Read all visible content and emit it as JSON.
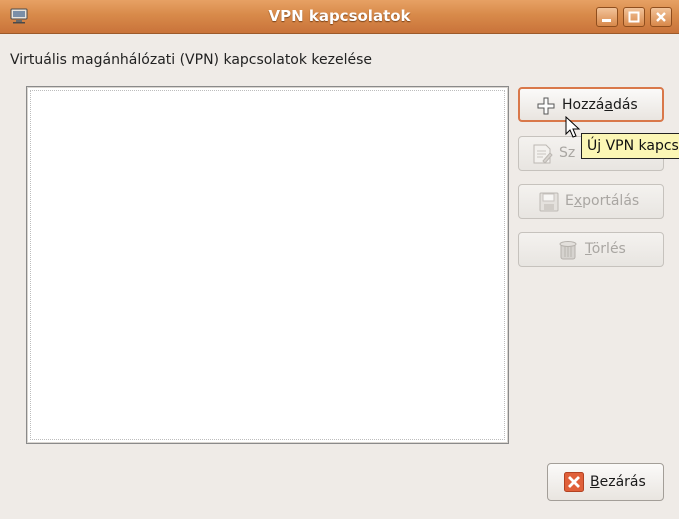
{
  "window": {
    "title": "VPN kapcsolatok"
  },
  "dialog": {
    "subtitle": "Virtuális magánhálózati (VPN) kapcsolatok kezelése",
    "buttons": {
      "add": {
        "pre": "Hozzá",
        "mn": "a",
        "post": "dás"
      },
      "edit": {
        "pre": "Sz",
        "mn": "",
        "post": ""
      },
      "export": {
        "pre": "E",
        "mn": "x",
        "post": "portálás"
      },
      "delete": {
        "pre": "",
        "mn": "T",
        "post": "örlés"
      },
      "close": {
        "pre": "",
        "mn": "B",
        "post": "ezárás"
      }
    },
    "tooltip": "Új VPN kapcs"
  },
  "icons": {
    "app": "network-icon",
    "add": "plus-icon",
    "edit": "edit-document-icon",
    "export": "floppy-disk-icon",
    "delete": "trash-can-icon",
    "close": "close-x-icon"
  },
  "colors": {
    "titlebar": "#d88a4a",
    "accent": "#d9784a",
    "close_icon": "#e0603a",
    "tooltip_bg": "#fbf6b5"
  }
}
